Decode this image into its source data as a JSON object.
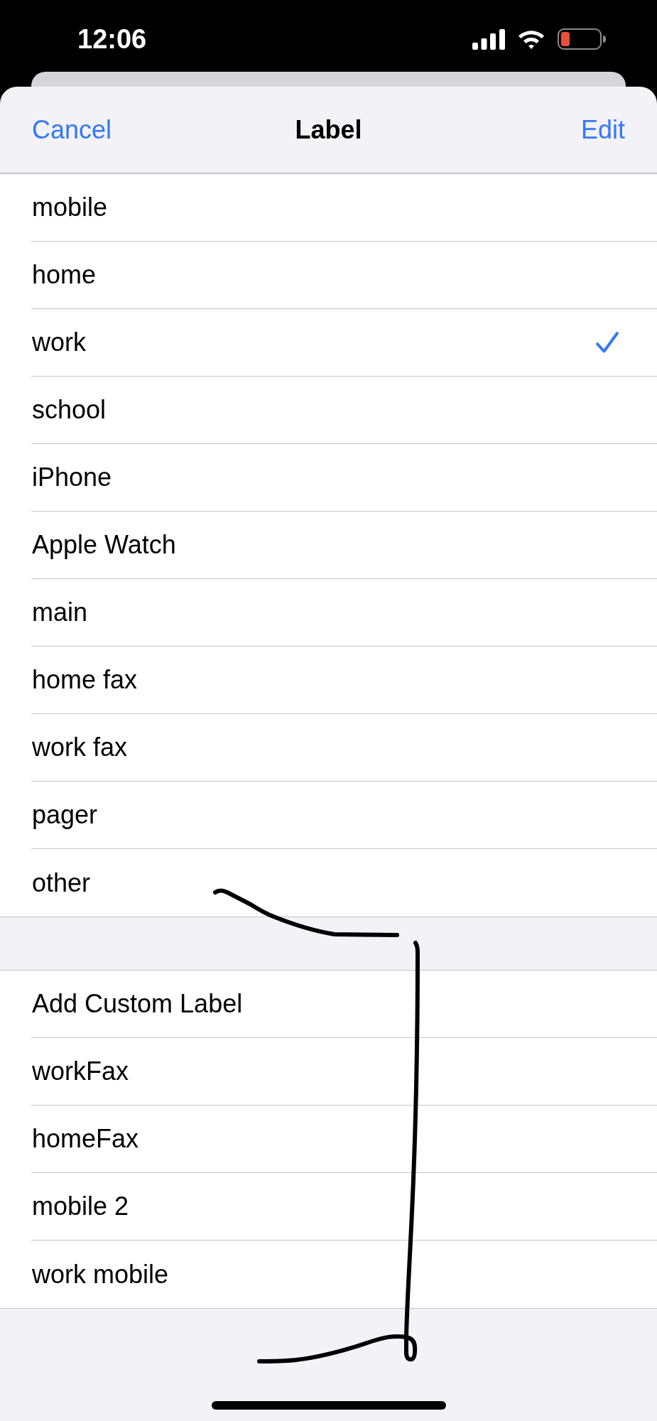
{
  "status_bar": {
    "time": "12:06"
  },
  "nav": {
    "cancel": "Cancel",
    "title": "Label",
    "edit": "Edit"
  },
  "sections": [
    {
      "items": [
        {
          "label": "mobile",
          "selected": false
        },
        {
          "label": "home",
          "selected": false
        },
        {
          "label": "work",
          "selected": true
        },
        {
          "label": "school",
          "selected": false
        },
        {
          "label": "iPhone",
          "selected": false
        },
        {
          "label": "Apple Watch",
          "selected": false
        },
        {
          "label": "main",
          "selected": false
        },
        {
          "label": "home fax",
          "selected": false
        },
        {
          "label": "work fax",
          "selected": false
        },
        {
          "label": "pager",
          "selected": false
        },
        {
          "label": "other",
          "selected": false
        }
      ]
    },
    {
      "items": [
        {
          "label": "Add Custom Label",
          "selected": false
        },
        {
          "label": "workFax",
          "selected": false
        },
        {
          "label": "homeFax",
          "selected": false
        },
        {
          "label": "mobile 2",
          "selected": false
        },
        {
          "label": "work mobile",
          "selected": false
        }
      ]
    }
  ]
}
